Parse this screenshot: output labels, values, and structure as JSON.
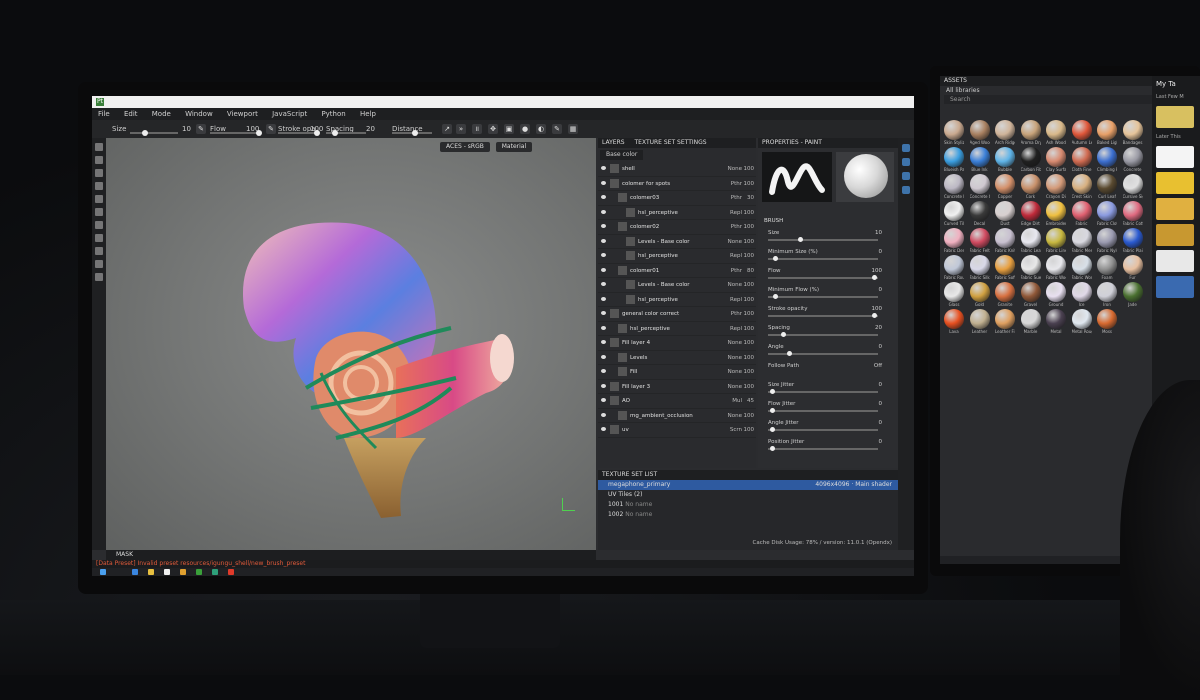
{
  "app": {
    "menu": [
      "File",
      "Edit",
      "Mode",
      "Window",
      "Viewport",
      "JavaScript",
      "Python",
      "Help"
    ]
  },
  "toolbar": {
    "size_label": "Size",
    "size_value": "10",
    "flow_label": "Flow",
    "flow_value": "100",
    "stroke_label": "Stroke opa",
    "stroke_value": "100",
    "spacing_label": "Spacing",
    "spacing_value": "20",
    "distance_label": "Distance"
  },
  "viewport": {
    "colorspace": "ACES - sRGB",
    "channel": "Material",
    "mask_label": "MASK"
  },
  "status": {
    "error": "[Data Preset] Invalid preset resources/igungu_shell/new_brush_preset"
  },
  "layers": {
    "tabs": [
      "LAYERS",
      "TEXTURE SET SETTINGS"
    ],
    "channel": "Base color",
    "rows": [
      {
        "name": "shell",
        "mode": "None",
        "op": "100",
        "indent": 0
      },
      {
        "name": "colomer for spots",
        "mode": "Pthr",
        "op": "100",
        "indent": 0
      },
      {
        "name": "colomer03",
        "mode": "Pthr",
        "op": "30",
        "indent": 1
      },
      {
        "name": "hsl_perceptive",
        "mode": "Repl",
        "op": "100",
        "indent": 2
      },
      {
        "name": "colomer02",
        "mode": "Pthr",
        "op": "100",
        "indent": 1
      },
      {
        "name": "Levels - Base color",
        "mode": "None",
        "op": "100",
        "indent": 2
      },
      {
        "name": "hsl_perceptive",
        "mode": "Repl",
        "op": "100",
        "indent": 2
      },
      {
        "name": "colomer01",
        "mode": "Pthr",
        "op": "80",
        "indent": 1
      },
      {
        "name": "Levels - Base color",
        "mode": "None",
        "op": "100",
        "indent": 2
      },
      {
        "name": "hsl_perceptive",
        "mode": "Repl",
        "op": "100",
        "indent": 2
      },
      {
        "name": "general color correct",
        "mode": "Pthr",
        "op": "100",
        "indent": 0
      },
      {
        "name": "hsl_perceptive",
        "mode": "Repl",
        "op": "100",
        "indent": 1
      },
      {
        "name": "Fill layer 4",
        "mode": "None",
        "op": "100",
        "indent": 0
      },
      {
        "name": "Levels",
        "mode": "None",
        "op": "100",
        "indent": 1
      },
      {
        "name": "Fill",
        "mode": "None",
        "op": "100",
        "indent": 1
      },
      {
        "name": "Fill layer 3",
        "mode": "None",
        "op": "100",
        "indent": 0
      },
      {
        "name": "AO",
        "mode": "Mul",
        "op": "45",
        "indent": 0
      },
      {
        "name": "mg_ambient_occlusion",
        "mode": "None",
        "op": "100",
        "indent": 1
      },
      {
        "name": "uv",
        "mode": "Scrn",
        "op": "100",
        "indent": 0
      }
    ]
  },
  "texture_set_list": {
    "title": "TEXTURE SET LIST",
    "primary": "megaphone_primary",
    "size": "4096x4096",
    "shader": "Main shader",
    "uv_tiles": "UV Tiles (2)",
    "tile1": "1001",
    "tile2": "1002",
    "tile_note": "No name",
    "cache": "Cache Disk Usage:",
    "version": "78% / version: 11.0.1 (Opendx)"
  },
  "properties": {
    "title": "PROPERTIES - PAINT",
    "section": "BRUSH",
    "rows": [
      {
        "label": "Size",
        "value": "10",
        "pos": 0.28
      },
      {
        "label": "Minimum Size (%)",
        "value": "0",
        "pos": 0.05
      },
      {
        "label": "Flow",
        "value": "100",
        "pos": 0.98
      },
      {
        "label": "Minimum Flow (%)",
        "value": "0",
        "pos": 0.05
      },
      {
        "label": "Stroke opacity",
        "value": "100",
        "pos": 0.98
      },
      {
        "label": "Spacing",
        "value": "20",
        "pos": 0.12
      },
      {
        "label": "Angle",
        "value": "0",
        "pos": 0.18
      },
      {
        "label": "Follow Path",
        "value": "Off",
        "pos": -1
      },
      {
        "label": "Size Jitter",
        "value": "0",
        "pos": 0.02
      },
      {
        "label": "Flow Jitter",
        "value": "0",
        "pos": 0.02
      },
      {
        "label": "Angle Jitter",
        "value": "0",
        "pos": 0.02
      },
      {
        "label": "Position Jitter",
        "value": "0",
        "pos": 0.02
      }
    ]
  },
  "assets": {
    "title": "ASSETS",
    "library": "All libraries",
    "search": "Search",
    "side_title": "My Ta",
    "side_sub1": "Last Few M",
    "side_sub2": "Later This",
    "items": [
      {
        "label": "Skin Stylized",
        "color": "#c9a98f"
      },
      {
        "label": "Aged Wood",
        "color": "#a88060"
      },
      {
        "label": "Arch Ridged",
        "color": "#d0b49a"
      },
      {
        "label": "Aroma Dry",
        "color": "#c7a37a"
      },
      {
        "label": "Ash Wood",
        "color": "#d9b98a"
      },
      {
        "label": "Autumn Leaf",
        "color": "#e0573a"
      },
      {
        "label": "Baked Light",
        "color": "#e8a068"
      },
      {
        "label": "Bandages",
        "color": "#e6c49a"
      },
      {
        "label": "Blueish Paint",
        "color": "#3a9ee0"
      },
      {
        "label": "Blue Ink",
        "color": "#3a7fd8"
      },
      {
        "label": "Bubble",
        "color": "#5fb4e8"
      },
      {
        "label": "Carbon Fiber",
        "color": "#202020"
      },
      {
        "label": "Clay Surface",
        "color": "#d88a70"
      },
      {
        "label": "Cloth Fine",
        "color": "#d06a50"
      },
      {
        "label": "Climbing Rope",
        "color": "#3c6fd0"
      },
      {
        "label": "Concrete",
        "color": "#9a9aa4"
      },
      {
        "label": "Concrete Dirty",
        "color": "#bcb8c4"
      },
      {
        "label": "Concrete Old",
        "color": "#cfc8d0"
      },
      {
        "label": "Copper",
        "color": "#d4906a"
      },
      {
        "label": "Cork",
        "color": "#c8906a"
      },
      {
        "label": "Crayon Dirt",
        "color": "#d49a78"
      },
      {
        "label": "Crest Skin",
        "color": "#d8b080"
      },
      {
        "label": "Curl Leaf",
        "color": "#5a4a30"
      },
      {
        "label": "Cursive Sign",
        "color": "#e0e0e0"
      },
      {
        "label": "Curved Tile",
        "color": "#f0f0f0"
      },
      {
        "label": "Decal",
        "color": "#3a3a3a"
      },
      {
        "label": "Dust",
        "color": "#d8d0d0"
      },
      {
        "label": "Edge Dirt",
        "color": "#c02a3a"
      },
      {
        "label": "Embroidery",
        "color": "#f0c040"
      },
      {
        "label": "Fabric",
        "color": "#e06070"
      },
      {
        "label": "Fabric Cloth",
        "color": "#8a9ae0"
      },
      {
        "label": "Fabric Cotton",
        "color": "#e06a80"
      },
      {
        "label": "Fabric Denim",
        "color": "#f0b0c0"
      },
      {
        "label": "Fabric Felt",
        "color": "#d04a60"
      },
      {
        "label": "Fabric Knit",
        "color": "#c8c0d0"
      },
      {
        "label": "Fabric Leather",
        "color": "#e8e8f0"
      },
      {
        "label": "Fabric Linen",
        "color": "#c8b840"
      },
      {
        "label": "Fabric Mesh",
        "color": "#d8d8e0"
      },
      {
        "label": "Fabric Nylon",
        "color": "#9a9ab0"
      },
      {
        "label": "Fabric Plain",
        "color": "#2a5ad0"
      },
      {
        "label": "Fabric Rough",
        "color": "#c0c8d8"
      },
      {
        "label": "Fabric Silk",
        "color": "#d8d8e8"
      },
      {
        "label": "Fabric Soft",
        "color": "#e8a040"
      },
      {
        "label": "Fabric Suede",
        "color": "#e8e8e8"
      },
      {
        "label": "Fabric Wool",
        "color": "#e8e8ec"
      },
      {
        "label": "Fabric Worn",
        "color": "#d8e0e8"
      },
      {
        "label": "Foam",
        "color": "#909090"
      },
      {
        "label": "Fur",
        "color": "#e8c0a0"
      },
      {
        "label": "Glass",
        "color": "#e8e8e8"
      },
      {
        "label": "Gold",
        "color": "#d0a040"
      },
      {
        "label": "Granite",
        "color": "#d87040"
      },
      {
        "label": "Gravel",
        "color": "#905838"
      },
      {
        "label": "Ground",
        "color": "#e8e0f0"
      },
      {
        "label": "Ice",
        "color": "#e0d8e8"
      },
      {
        "label": "Iron",
        "color": "#d0d0d8"
      },
      {
        "label": "Jade",
        "color": "#4a7030"
      },
      {
        "label": "Lava",
        "color": "#e85020"
      },
      {
        "label": "Leather",
        "color": "#c0b090"
      },
      {
        "label": "Leather Fine",
        "color": "#e0a060"
      },
      {
        "label": "Marble",
        "color": "#d8d8d8"
      },
      {
        "label": "Metal",
        "color": "#4a4050"
      },
      {
        "label": "Metal Rough",
        "color": "#e0e8f0"
      },
      {
        "label": "Moss",
        "color": "#d86a30"
      }
    ]
  }
}
